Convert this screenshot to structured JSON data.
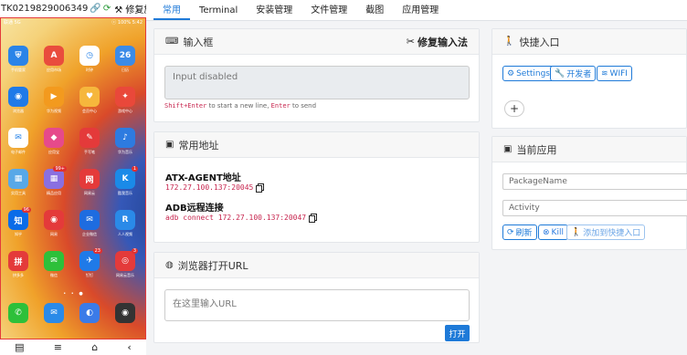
{
  "device": {
    "serial": "TK0219829006349",
    "fix_label": "修复旋",
    "status_left": "联通 5G  ",
    "status_right": "ⓒ 100%  5:42"
  },
  "apps": [
    {
      "label": "手机管家",
      "color": "#2a84e8",
      "glyph": "⛨"
    },
    {
      "label": "应用市场",
      "color": "#e94c3d",
      "glyph": "A"
    },
    {
      "label": "时钟",
      "color": "#ffffff",
      "glyph": "◷"
    },
    {
      "label": "日历",
      "color": "#3b8be8",
      "glyph": "26"
    },
    {
      "label": "浏览器",
      "color": "#1f7ae8",
      "glyph": "◉"
    },
    {
      "label": "华为视频",
      "color": "#f39a1e",
      "glyph": "▶"
    },
    {
      "label": "会员中心",
      "color": "#f6b73c",
      "glyph": "♥"
    },
    {
      "label": "游戏中心",
      "color": "#e9483a",
      "glyph": "✦"
    },
    {
      "label": "电子邮件",
      "color": "#ffffff",
      "glyph": "✉"
    },
    {
      "label": "应用宝",
      "color": "#e64a8b",
      "glyph": "◆"
    },
    {
      "label": "手写笔",
      "color": "#e43a3a",
      "glyph": "✎"
    },
    {
      "label": "华为音乐",
      "color": "#2d7be0",
      "glyph": "♪"
    },
    {
      "label": "实用工具",
      "color": "#58a8e8",
      "glyph": "▦"
    },
    {
      "label": "精品应用",
      "color": "#8a6fe0",
      "glyph": "▦",
      "badge": "99+"
    },
    {
      "label": "网易云",
      "color": "#e43a3a",
      "glyph": "网"
    },
    {
      "label": "酷我音乐",
      "color": "#1a8ae8",
      "glyph": "K",
      "badge": "1"
    },
    {
      "label": "知乎",
      "color": "#0a6ce8",
      "glyph": "知",
      "badge": "96"
    },
    {
      "label": "网易",
      "color": "#e43a3a",
      "glyph": "◉"
    },
    {
      "label": "企业微信",
      "color": "#1e6ce0",
      "glyph": "✉"
    },
    {
      "label": "人人视频",
      "color": "#2a8ae8",
      "glyph": "R"
    },
    {
      "label": "拼多多",
      "color": "#e43a3a",
      "glyph": "拼"
    },
    {
      "label": "微信",
      "color": "#2dc03a",
      "glyph": "✉"
    },
    {
      "label": "钉钉",
      "color": "#1f7ae8",
      "glyph": "✈",
      "badge": "23"
    },
    {
      "label": "网易云音乐",
      "color": "#e43a3a",
      "glyph": "◎",
      "badge": "3"
    }
  ],
  "dock": [
    {
      "label": "电话",
      "color": "#2dc03a",
      "glyph": "✆"
    },
    {
      "label": "信息",
      "color": "#2a8ae8",
      "glyph": "✉"
    },
    {
      "label": "浏览器",
      "color": "#3b7be8",
      "glyph": "◐"
    },
    {
      "label": "相机",
      "color": "#333333",
      "glyph": "◉"
    }
  ],
  "navbar": [
    "▤",
    "≡",
    "⌂",
    "‹"
  ],
  "tabs": [
    "常用",
    "Terminal",
    "安装管理",
    "文件管理",
    "截图",
    "应用管理"
  ],
  "input_card": {
    "title": "输入框",
    "fix_button": "修复输入法",
    "placeholder": "Input disabled",
    "hint_key1": "Shift+Enter",
    "hint_mid": " to start a new line, ",
    "hint_key2": "Enter",
    "hint_end": " to send"
  },
  "address_card": {
    "title": "常用地址",
    "atx_label": "ATX-AGENT地址",
    "atx_value": "172.27.100.137:20045",
    "adb_label": "ADB远程连接",
    "adb_value": "adb connect 172.27.100.137:20047"
  },
  "url_card": {
    "title": "浏览器打开URL",
    "placeholder": "在这里输入URL",
    "open_button": "打开"
  },
  "shortcut_card": {
    "title": "快捷入口",
    "buttons": [
      "Settings",
      "开发者",
      "WIFI"
    ],
    "add": "+"
  },
  "current_app_card": {
    "title": "当前应用",
    "package_placeholder": "PackageName",
    "activity_placeholder": "Activity",
    "refresh": "刷新",
    "kill": "Kill",
    "add_shortcut": "添加到快捷入口"
  },
  "colors": {
    "accent": "#1e7ad8",
    "code": "#c7254e",
    "phone_border": "#e43a3a"
  }
}
